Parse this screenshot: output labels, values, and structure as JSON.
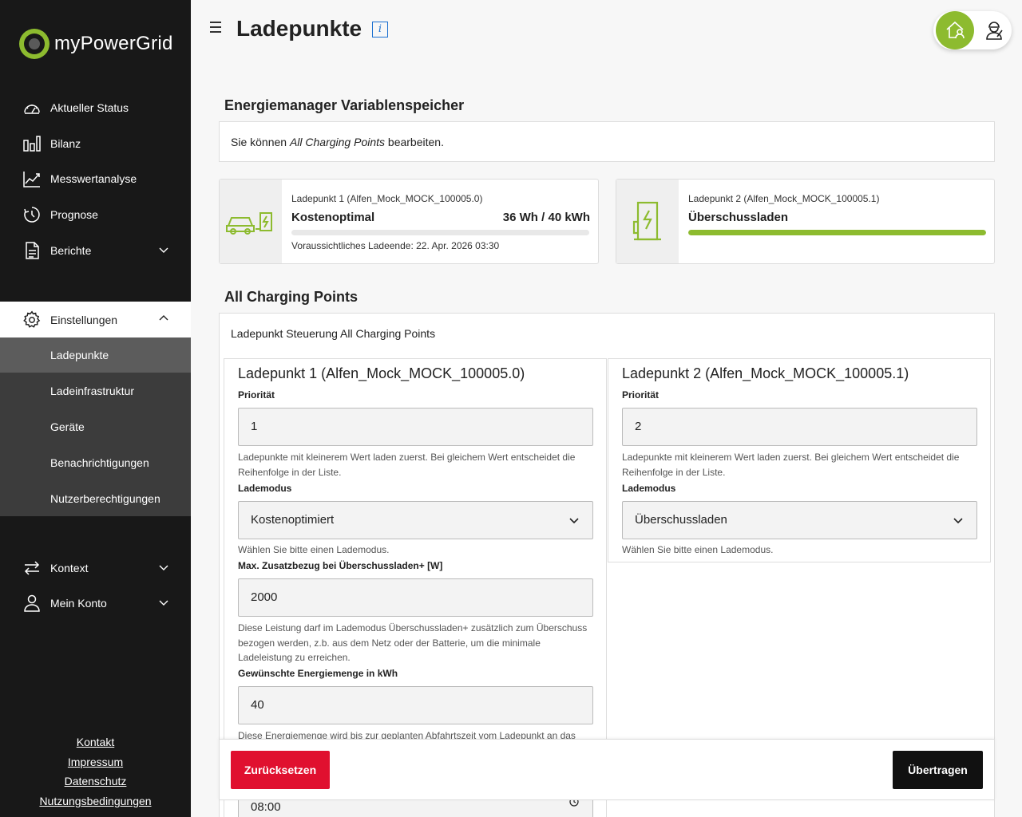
{
  "brand": {
    "name": "myPowerGrid",
    "accent": "#8dbb2f"
  },
  "sidebar": {
    "items": [
      {
        "label": "Aktueller Status",
        "icon": "gauge-icon"
      },
      {
        "label": "Bilanz",
        "icon": "bar-chart-icon"
      },
      {
        "label": "Messwertanalyse",
        "icon": "line-chart-icon"
      },
      {
        "label": "Prognose",
        "icon": "forecast-icon"
      },
      {
        "label": "Berichte",
        "icon": "document-icon"
      },
      {
        "label": "Einstellungen",
        "icon": "gear-icon"
      },
      {
        "label": "Kontext",
        "icon": "swap-arrows-icon"
      },
      {
        "label": "Mein Konto",
        "icon": "user-icon"
      }
    ],
    "settings_sub": [
      "Ladepunkte",
      "Ladeinfrastruktur",
      "Geräte",
      "Benachrichtigungen",
      "Nutzerberechtigungen"
    ],
    "footer_links": [
      "Kontakt",
      "Impressum",
      "Datenschutz",
      "Nutzungsbedingungen"
    ]
  },
  "header": {
    "title": "Ladepunkte",
    "info_icon": "i"
  },
  "variables": {
    "title": "Energiemanager Variablenspeicher",
    "info_pre": "Sie können ",
    "info_em": "All Charging Points",
    "info_post": " bearbeiten."
  },
  "cards": [
    {
      "name": "Ladepunkt 1 (Alfen_Mock_MOCK_100005.0)",
      "mode": "Kostenoptimal",
      "energy": "36 Wh / 40 kWh",
      "progress": 0.0,
      "end": "Voraussichtliches Ladeende: 22. Apr. 2026 03:30"
    },
    {
      "name": "Ladepunkt 2 (Alfen_Mock_MOCK_100005.1)",
      "mode": "Überschussladen",
      "progress": 1.0
    }
  ],
  "acp": {
    "title": "All Charging Points",
    "subtitle": "Ladepunkt Steuerung All Charging Points",
    "lp1": {
      "title": "Ladepunkt 1 (Alfen_Mock_MOCK_100005.0)",
      "prio_label": "Priorität",
      "prio_value": "1",
      "prio_help": "Ladepunkte mit kleinerem Wert laden zuerst. Bei gleichem Wert entscheidet die Reihenfolge in der Liste.",
      "mode_label": "Lademodus",
      "mode_value": "Kostenoptimiert",
      "mode_help": "Wählen Sie bitte einen Lademodus.",
      "max_label": "Max. Zusatzbezug bei Überschussladen+ [W]",
      "max_value": "2000",
      "max_help": "Diese Leistung darf im Lademodus Überschussladen+ zusätzlich zum Überschuss bezogen werden, z.b. aus dem Netz oder der Batterie, um die minimale Ladeleistung zu erreichen.",
      "energy_label": "Gewünschte Energiemenge in kWh",
      "energy_value": "40",
      "energy_help": "Diese Energiemenge wird bis zur geplanten Abfahrtszeit vom Ladepunkt an das",
      "time_value": "08:00"
    },
    "lp2": {
      "title": "Ladepunkt 2 (Alfen_Mock_MOCK_100005.1)",
      "prio_label": "Priorität",
      "prio_value": "2",
      "prio_help": "Ladepunkte mit kleinerem Wert laden zuerst. Bei gleichem Wert entscheidet die Reihenfolge in der Liste.",
      "mode_label": "Lademodus",
      "mode_value": "Überschussladen",
      "mode_help": "Wählen Sie bitte einen Lademodus."
    }
  },
  "actions": {
    "reset": "Zurücksetzen",
    "submit": "Übertragen"
  }
}
